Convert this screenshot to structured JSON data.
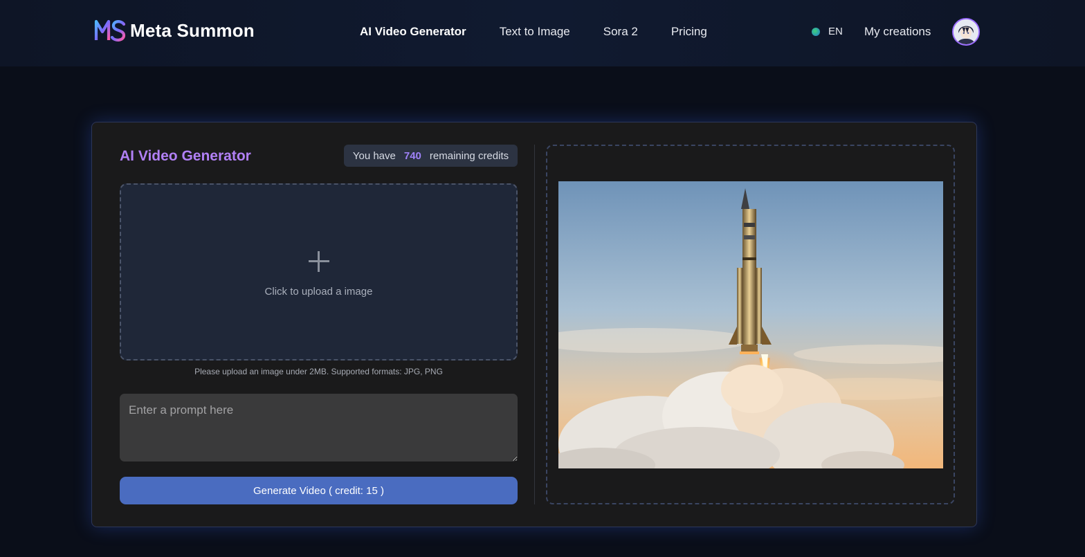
{
  "brand": {
    "name": "Meta Summon",
    "accent": "#b180f5"
  },
  "nav": {
    "items": [
      {
        "label": "AI Video Generator",
        "active": true
      },
      {
        "label": "Text to Image",
        "active": false
      },
      {
        "label": "Sora 2",
        "active": false
      },
      {
        "label": "Pricing",
        "active": false
      }
    ]
  },
  "header_right": {
    "language": "EN",
    "my_creations": "My creations"
  },
  "generator": {
    "title": "AI Video Generator",
    "credits": {
      "prefix": "You have",
      "count": "740",
      "suffix": "remaining credits"
    },
    "upload": {
      "label": "Click to upload a image",
      "hint": "Please upload an image under 2MB. Supported formats: JPG, PNG"
    },
    "prompt": {
      "placeholder": "Enter a prompt here",
      "value": ""
    },
    "generate_button": "Generate Video ( credit: 15 )",
    "button_color": "#4a6cc0"
  }
}
